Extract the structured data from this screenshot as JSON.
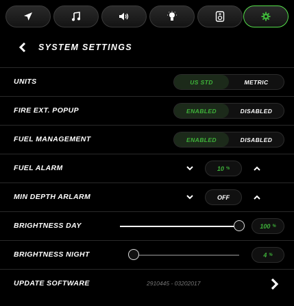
{
  "tabs": [
    {
      "icon": "navigation-arrow-icon"
    },
    {
      "icon": "music-note-icon"
    },
    {
      "icon": "speaker-volume-icon"
    },
    {
      "icon": "light-bulb-icon"
    },
    {
      "icon": "device-remote-icon"
    },
    {
      "icon": "gear-icon",
      "active": true
    }
  ],
  "header": {
    "title": "SYSTEM SETTINGS"
  },
  "settings": {
    "units": {
      "label": "UNITS",
      "options": [
        "US STD",
        "METRIC"
      ],
      "selected": "US STD"
    },
    "fire": {
      "label": "FIRE EXT. POPUP",
      "options": [
        "ENABLED",
        "DISABLED"
      ],
      "selected": "ENABLED"
    },
    "fuel_mgmt": {
      "label": "FUEL MANAGEMENT",
      "options": [
        "ENABLED",
        "DISABLED"
      ],
      "selected": "ENABLED"
    },
    "fuel_alarm": {
      "label": "FUEL ALARM",
      "value": "10",
      "unit": "%"
    },
    "depth_alarm": {
      "label": "MIN DEPTH ARLARM",
      "value": "OFF"
    },
    "bright_day": {
      "label": "BRIGHTNESS DAY",
      "value": "100",
      "unit": "%",
      "level": 100
    },
    "bright_night": {
      "label": "BRIGHTNESS NIGHT",
      "value": "4",
      "unit": "%",
      "level": 4
    },
    "update": {
      "label": "UPDATE SOFTWARE",
      "version": "2910445 - 03202017"
    }
  },
  "colors": {
    "accent": "#3fb43a",
    "active_tab_border": "#55e04a",
    "background": "#000000"
  }
}
